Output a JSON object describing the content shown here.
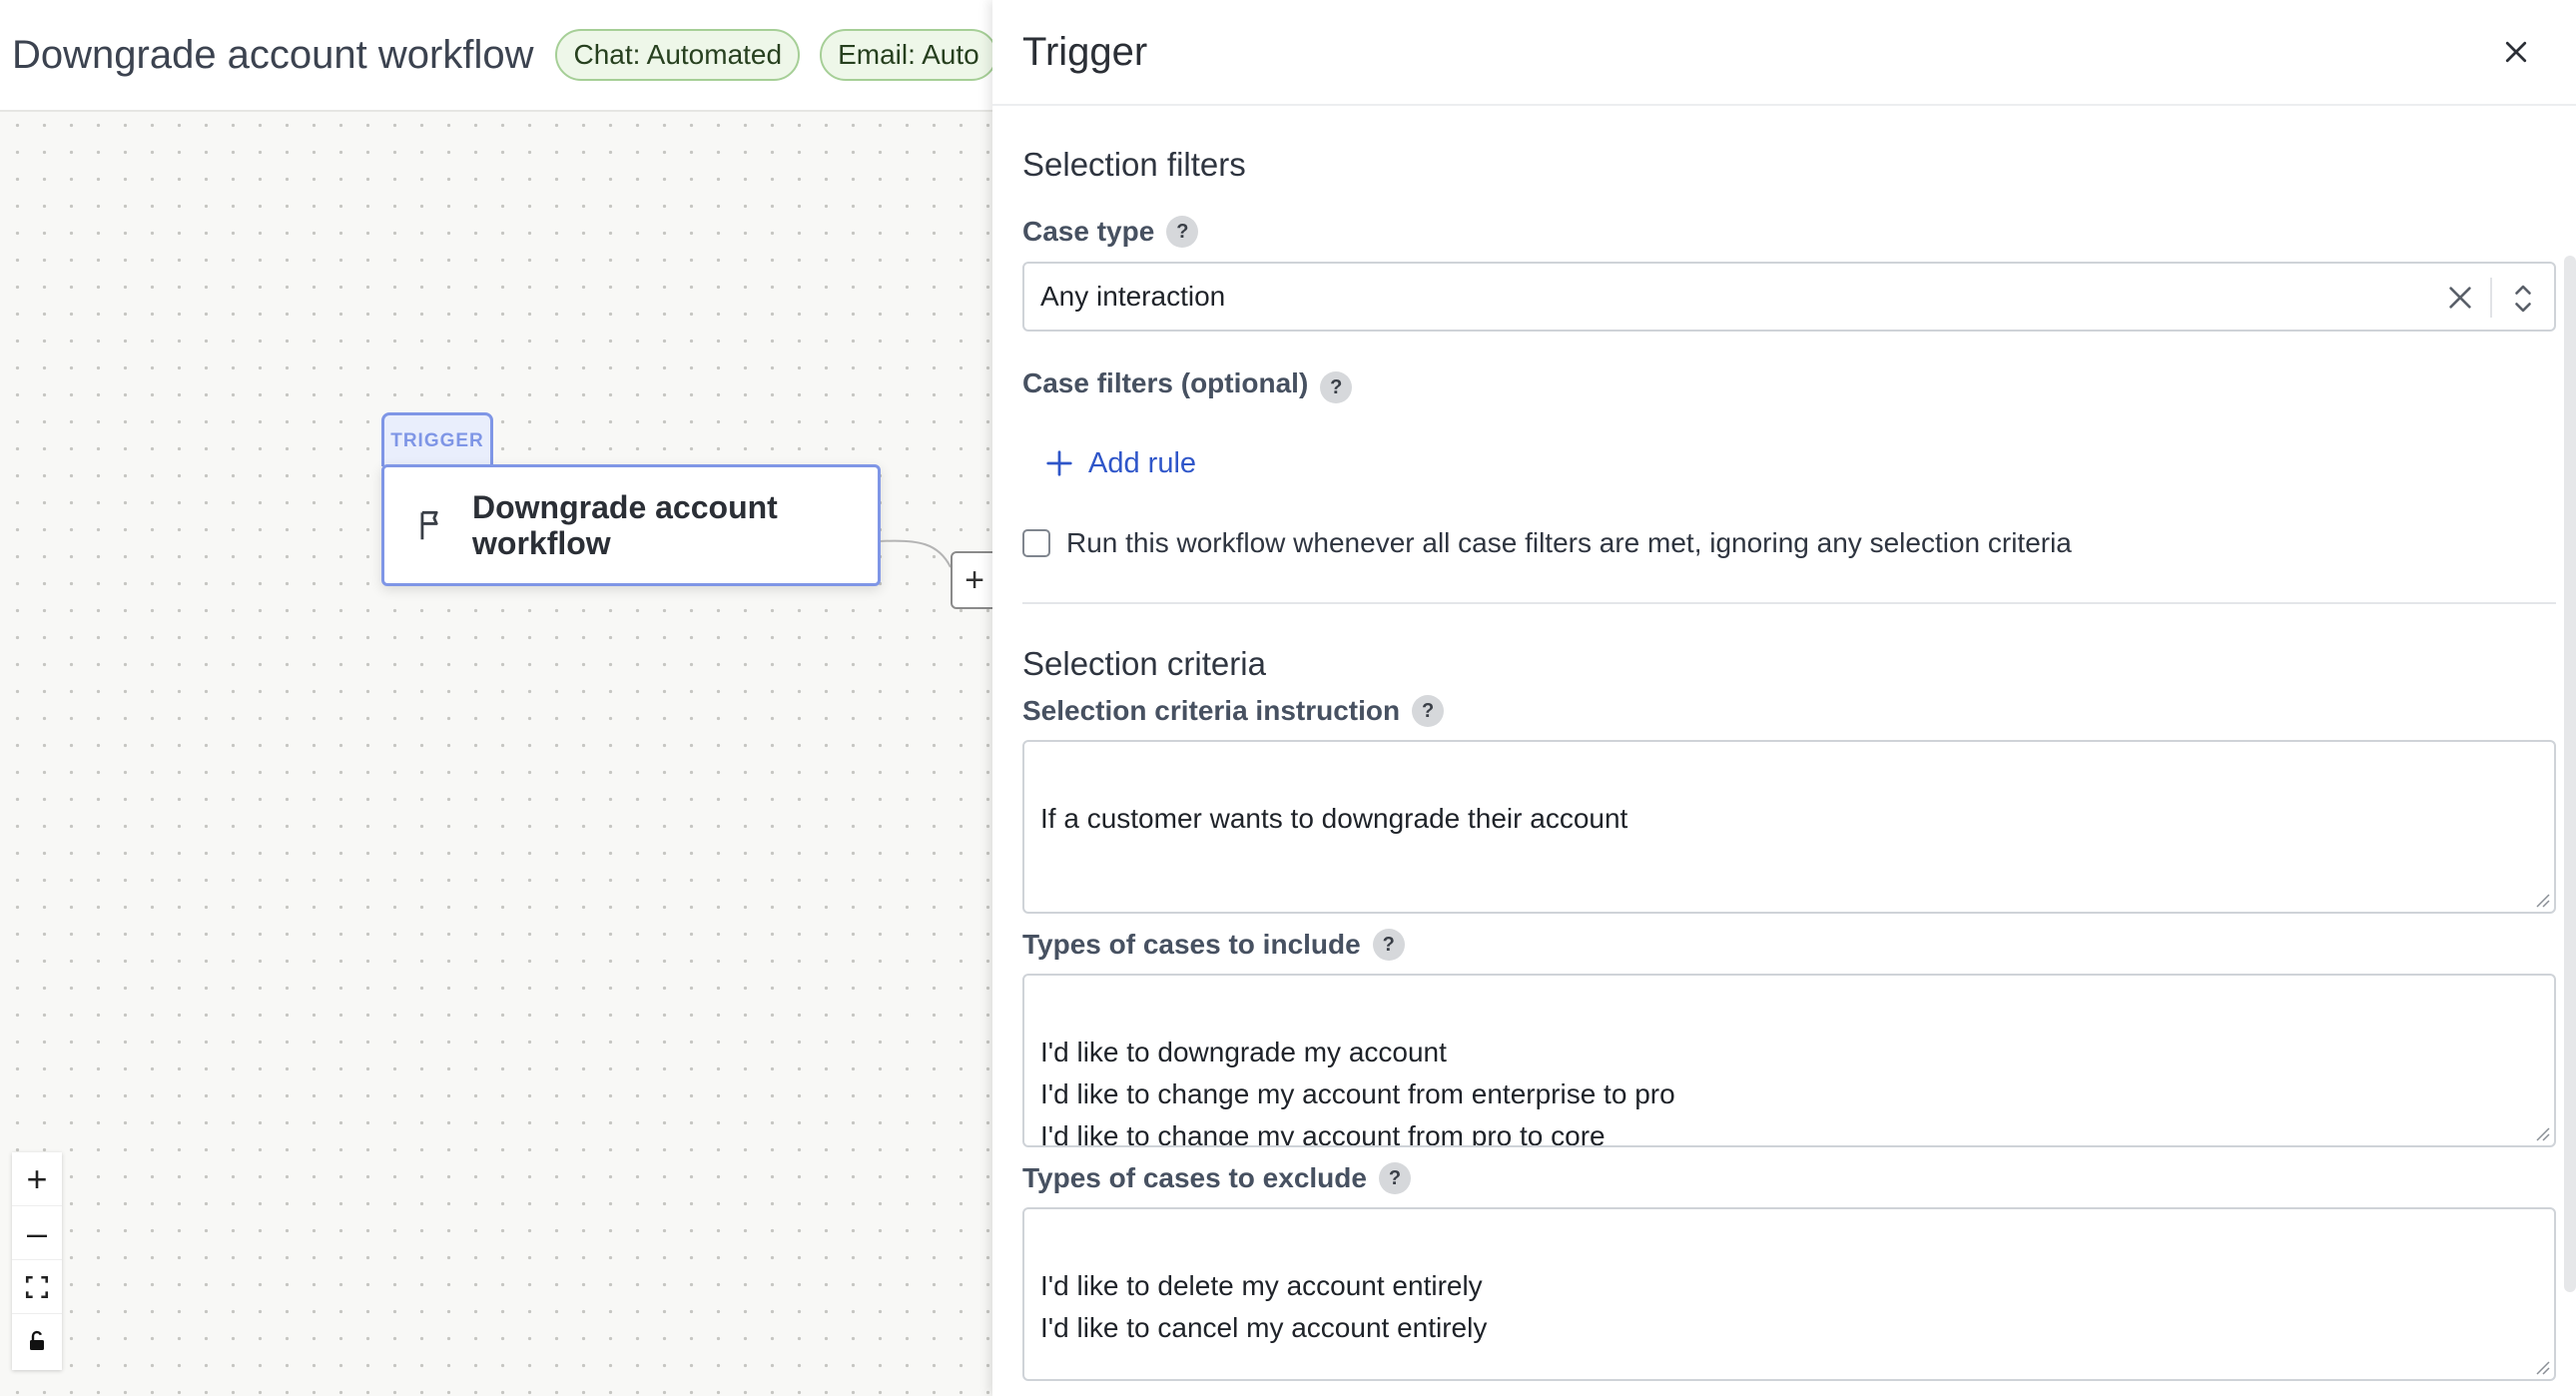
{
  "canvas": {
    "title": "Downgrade account workflow",
    "pills": [
      "Chat: Automated",
      "Email: Auto"
    ],
    "trigger_tag": "TRIGGER",
    "trigger_node_label": "Downgrade account workflow",
    "add_node_symbol": "+",
    "zoom_controls": {
      "zoom_in": "+",
      "zoom_out": "–",
      "fit_icon": "fit-view-icon",
      "lock_icon": "lock-icon"
    }
  },
  "panel": {
    "title": "Trigger",
    "close_icon": "close-icon",
    "selection_filters": {
      "section_title": "Selection filters",
      "case_type_label": "Case type",
      "case_type_value": "Any interaction",
      "case_filters_label": "Case filters (optional)",
      "add_rule_label": "Add rule",
      "run_checkbox_label": "Run this workflow whenever all case filters are met, ignoring any selection criteria",
      "run_checkbox_checked": false
    },
    "selection_criteria": {
      "section_title": "Selection criteria",
      "instruction_label": "Selection criteria instruction",
      "instruction_value": "If a customer wants to downgrade their account",
      "include_label": "Types of cases to include",
      "include_value": "I'd like to downgrade my account\nI'd like to change my account from enterprise to pro\nI'd like to change my account from pro to core\nI'd like to change my account from enterprise to core",
      "exclude_label": "Types of cases to exclude",
      "exclude_value": "I'd like to delete my account entirely\nI'd like to cancel my account entirely"
    },
    "help_symbol": "?"
  },
  "colors": {
    "accent_blue": "#2f56c9",
    "trigger_border": "#7f96e6",
    "pill_border": "#a6cf97",
    "pill_bg": "#eef7e9"
  }
}
